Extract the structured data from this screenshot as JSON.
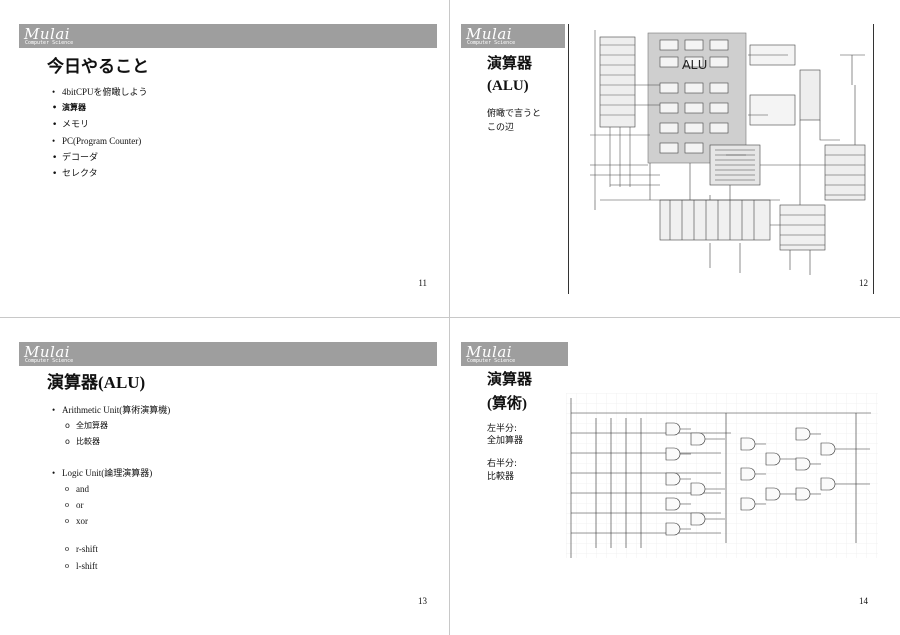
{
  "logo": {
    "text": "Mulai",
    "subtitle": "Computer Science"
  },
  "slide11": {
    "title": "今日やること",
    "bullets": [
      "4bitCPUを俯瞰しよう",
      "演算器",
      "メモリ",
      "PC(Program Counter)",
      "デコーダ",
      "セレクタ"
    ],
    "page": "11"
  },
  "slide12": {
    "title_line1": "演算器",
    "title_line2": "(ALU)",
    "note_line1": "俯瞰で言うと",
    "note_line2": "この辺",
    "alu_label": "ALU",
    "page": "12"
  },
  "slide13": {
    "title": "演算器(ALU)",
    "arith": {
      "label": "Arithmetic Unit(算術演算機)",
      "items": [
        "全加算器",
        "比較器"
      ]
    },
    "logic": {
      "label": "Logic Unit(論理演算器)",
      "items": [
        "and",
        "or",
        "xor"
      ],
      "items2": [
        "r-shift",
        "l-shift"
      ]
    },
    "page": "13"
  },
  "slide14": {
    "title_line1": "演算器",
    "title_line2": "(算術)",
    "left_label": "左半分:",
    "left_value": "全加算器",
    "right_label": "右半分:",
    "right_value": "比較器",
    "page": "14"
  }
}
